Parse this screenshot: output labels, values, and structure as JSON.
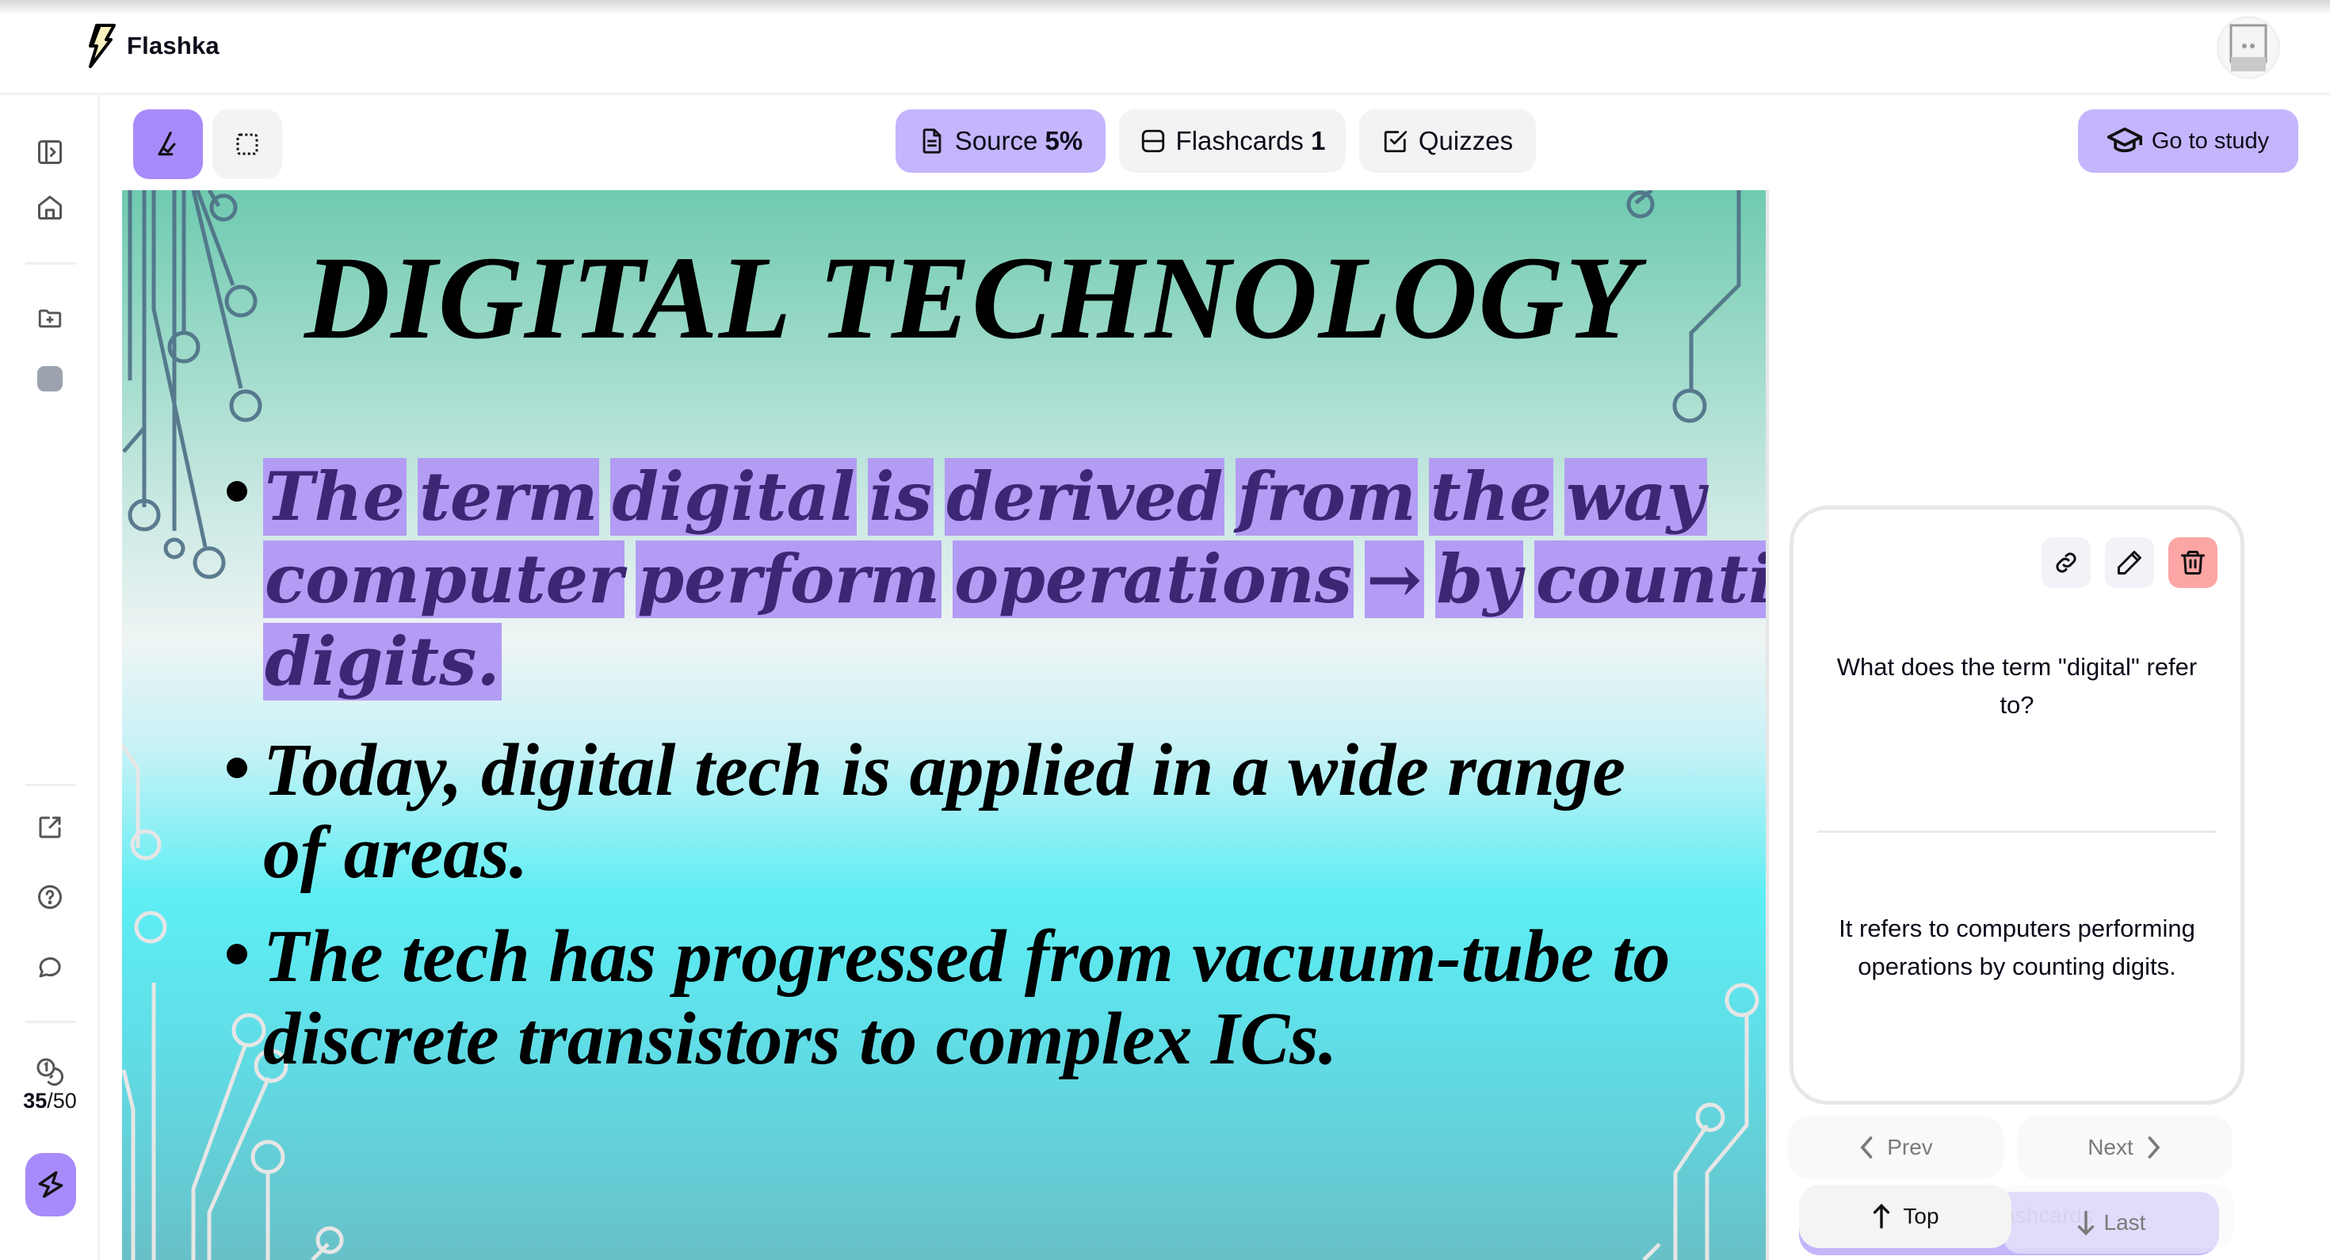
{
  "app": {
    "name": "Flashka",
    "logo_icon": "lightning-bolt-icon",
    "avatar_icon": "avatar-robot-icon"
  },
  "sidebar": {
    "items": [
      {
        "icon": "sidebar-toggle-icon",
        "label": "Toggle sidebar"
      },
      {
        "icon": "home-icon",
        "label": "Home"
      },
      {
        "icon": "folder-plus-icon",
        "label": "New folder"
      },
      {
        "icon": "folder-color-icon",
        "label": "Folder"
      },
      {
        "icon": "external-link-icon",
        "label": "Open external"
      },
      {
        "icon": "help-circle-icon",
        "label": "Help"
      },
      {
        "icon": "chat-bubble-icon",
        "label": "Feedback"
      }
    ],
    "credits": {
      "icon": "coins-icon",
      "used": "35",
      "separator": "/",
      "total": "50"
    },
    "action_icon": "lightning-bolt-icon"
  },
  "toolbar": {
    "highlight_tool": {
      "icon": "highlighter-icon",
      "active": true
    },
    "select_tool": {
      "icon": "dashed-rectangle-icon",
      "active": false
    },
    "tabs": [
      {
        "label": "Source",
        "badge": "5%",
        "icon": "document-icon",
        "active": true
      },
      {
        "label": "Flashcards",
        "badge": "1",
        "icon": "card-icon",
        "active": false
      },
      {
        "label": "Quizzes",
        "badge": "",
        "icon": "checkbox-icon",
        "active": false
      }
    ],
    "study_button": {
      "label": "Go to study",
      "icon": "graduation-cap-icon"
    }
  },
  "slide": {
    "title": "DIGITAL TECHNOLOGY",
    "bullets": [
      {
        "highlighted": true,
        "lines": [
          [
            "The",
            "term",
            "digital",
            "is",
            "derived",
            "from",
            "the",
            "way"
          ],
          [
            "computer",
            "perform",
            "operations",
            "→",
            "by",
            "counting"
          ],
          [
            "digits."
          ]
        ]
      },
      {
        "highlighted": false,
        "lines": [
          "Today, digital tech is applied in a wide range",
          "of areas."
        ]
      },
      {
        "highlighted": false,
        "lines": [
          "The tech has progressed from vacuum-tube to",
          "discrete transistors to complex ICs."
        ]
      }
    ]
  },
  "flashcard": {
    "actions": [
      {
        "icon": "link-icon",
        "label": "Link"
      },
      {
        "icon": "pencil-icon",
        "label": "Edit"
      },
      {
        "icon": "trash-icon",
        "label": "Delete"
      }
    ],
    "question": "What does the term \"digital\" refer to?",
    "answer": "It refers to computers performing operations by counting digits."
  },
  "navigation": {
    "prev": "Prev",
    "next": "Next",
    "top": "Top",
    "last": "Last",
    "bar_label": "e flashcards"
  },
  "colors": {
    "accent": "#a78bfa",
    "accent_light": "#c4b5fd",
    "highlight": "#b39cf3",
    "danger": "#fca5a5"
  }
}
